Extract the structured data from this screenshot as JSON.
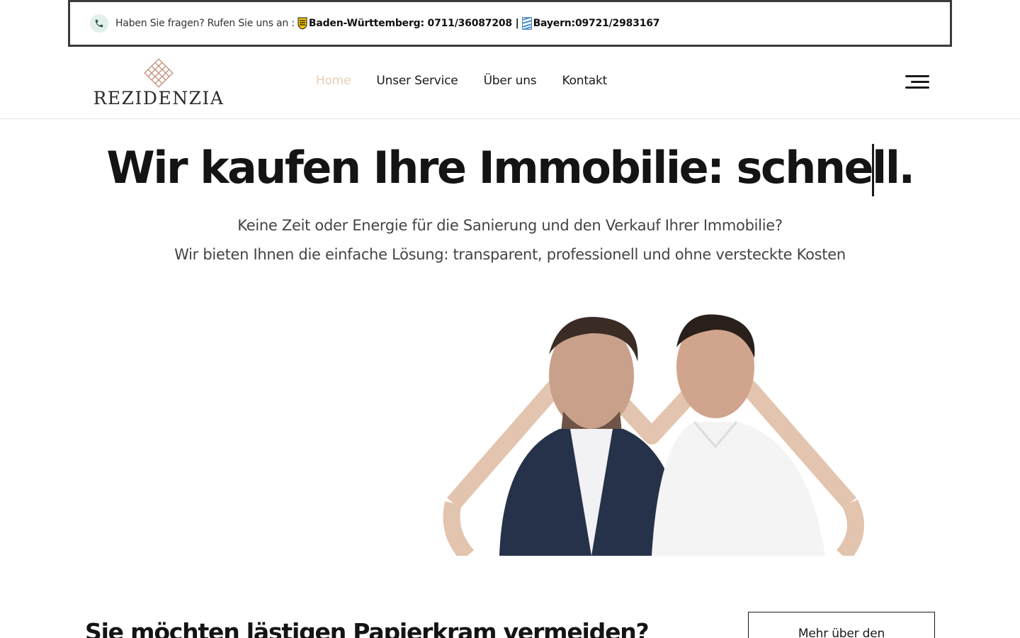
{
  "topbar": {
    "prefix": "Haben Sie fragen? Rufen Sie uns an :",
    "bw_label": "Baden-Württemberg: 0711/36087208 |",
    "bayern_label": "Bayern:09721/2983167"
  },
  "header": {
    "logo_text": "REZIDENZIA",
    "nav": [
      {
        "label": "Home"
      },
      {
        "label": "Unser Service"
      },
      {
        "label": "Über uns"
      },
      {
        "label": "Kontakt"
      }
    ]
  },
  "hero": {
    "title": "Wir kaufen Ihre Immobilie: schnell.",
    "subtitle_1": "Keine Zeit oder Energie für die Sanierung und den Verkauf Ihrer Immobilie?",
    "subtitle_2": "Wir bieten Ihnen die einfache Lösung: transparent, professionell und ohne versteckte Kosten"
  },
  "section": {
    "title": "Sie möchten lästigen Papierkram vermeiden?",
    "button_label": "Mehr über den"
  },
  "colors": {
    "accent": "#e8cdb5",
    "logo_lattice": "#c49580",
    "phone_bg": "#e3efe9",
    "text": "#1a1a1a"
  },
  "icons": [
    "phone-icon",
    "bw-flag-icon",
    "bayern-flag-icon",
    "menu-icon"
  ]
}
